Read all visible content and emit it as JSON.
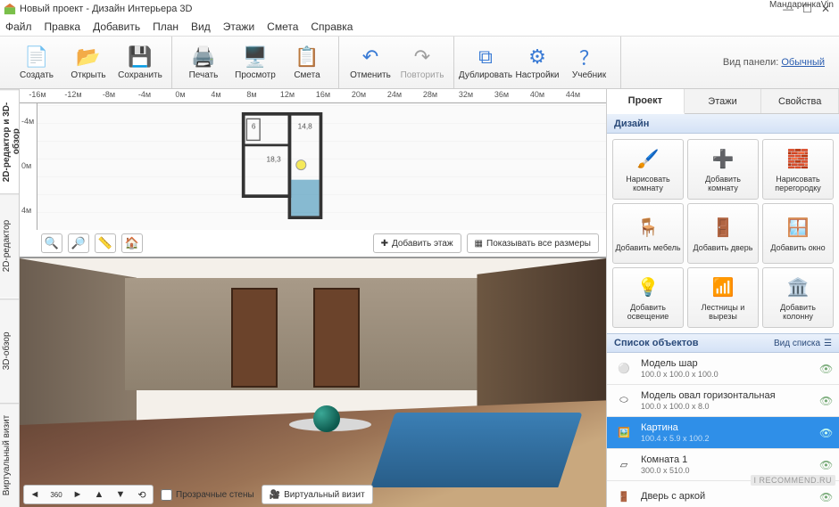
{
  "watermark_user": "МандаринкаVin",
  "watermark_site": "I RECOMMEND.RU",
  "window": {
    "title": "Новый проект - Дизайн Интерьера 3D"
  },
  "menu": [
    "Файл",
    "Правка",
    "Добавить",
    "План",
    "Вид",
    "Этажи",
    "Смета",
    "Справка"
  ],
  "toolbar": {
    "create": "Создать",
    "open": "Открыть",
    "save": "Сохранить",
    "print": "Печать",
    "preview": "Просмотр",
    "estimate": "Смета",
    "undo": "Отменить",
    "redo": "Повторить",
    "duplicate": "Дублировать",
    "settings": "Настройки",
    "tutorial": "Учебник"
  },
  "panel_mode": {
    "label": "Вид панели:",
    "value": "Обычный"
  },
  "left_tabs": [
    "2D-редактор и 3D-обзор",
    "2D-редактор",
    "3D-обзор",
    "Виртуальный визит"
  ],
  "ruler_h": [
    "-16м",
    "-12м",
    "-8м",
    "-4м",
    "0м",
    "4м",
    "8м",
    "12м",
    "16м",
    "20м",
    "24м",
    "28м",
    "32м",
    "36м",
    "40м",
    "44м"
  ],
  "ruler_v": [
    "-4м",
    "0м",
    "4м"
  ],
  "view2d_actions": {
    "add_floor": "Добавить этаж",
    "show_dims": "Показывать все размеры"
  },
  "bottom": {
    "transparent_walls": "Прозрачные стены",
    "virtual_visit": "Виртуальный визит"
  },
  "rp_tabs": [
    "Проект",
    "Этажи",
    "Свойства"
  ],
  "design_header": "Дизайн",
  "design_buttons": [
    {
      "label": "Нарисовать комнату"
    },
    {
      "label": "Добавить комнату"
    },
    {
      "label": "Нарисовать перегородку"
    },
    {
      "label": "Добавить мебель"
    },
    {
      "label": "Добавить дверь"
    },
    {
      "label": "Добавить окно"
    },
    {
      "label": "Добавить освещение"
    },
    {
      "label": "Лестницы и вырезы"
    },
    {
      "label": "Добавить колонну"
    }
  ],
  "objects_header": "Список объектов",
  "objects_view_mode": "Вид списка",
  "objects": [
    {
      "name": "Модель шар",
      "dim": "100.0 x 100.0 x 100.0",
      "selected": false,
      "icon": "sphere"
    },
    {
      "name": "Модель овал горизонтальная",
      "dim": "100.0 x 100.0 x 8.0",
      "selected": false,
      "icon": "oval"
    },
    {
      "name": "Картина",
      "dim": "100.4 x 5.9 x 100.2",
      "selected": true,
      "icon": "picture"
    },
    {
      "name": "Комната 1",
      "dim": "300.0 x 510.0",
      "selected": false,
      "icon": "room"
    },
    {
      "name": "Дверь с аркой",
      "dim": "",
      "selected": false,
      "icon": "door"
    }
  ]
}
